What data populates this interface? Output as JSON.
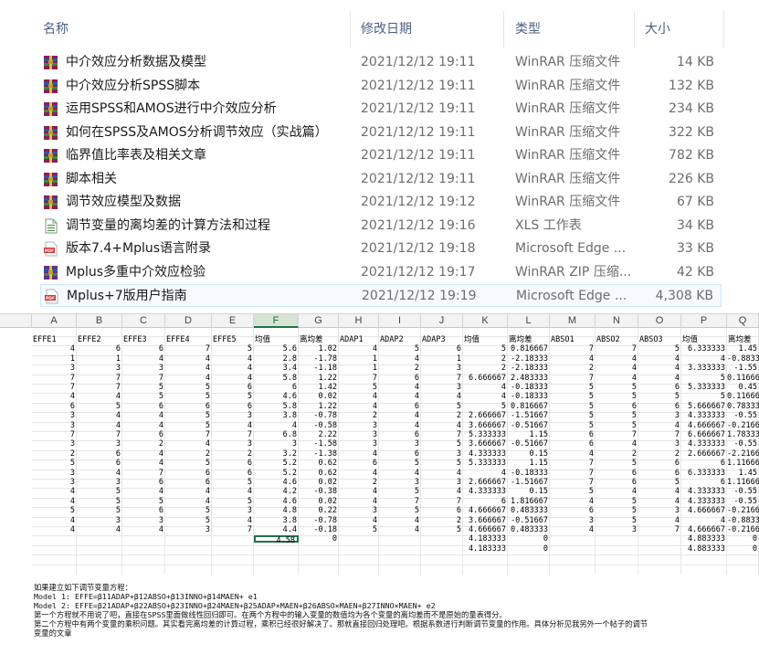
{
  "explorer": {
    "headers": {
      "name": "名称",
      "date": "修改日期",
      "type": "类型",
      "size": "大小"
    },
    "files": [
      {
        "name": "中介效应分析数据及模型",
        "date": "2021/12/12 19:11",
        "type": "WinRAR 压缩文件",
        "size": "14 KB",
        "icon": "winrar-archive-icon"
      },
      {
        "name": "中介效应分析SPSS脚本",
        "date": "2021/12/12 19:11",
        "type": "WinRAR 压缩文件",
        "size": "132 KB",
        "icon": "winrar-archive-icon"
      },
      {
        "name": "运用SPSS和AMOS进行中介效应分析",
        "date": "2021/12/12 19:11",
        "type": "WinRAR 压缩文件",
        "size": "234 KB",
        "icon": "winrar-archive-icon"
      },
      {
        "name": "如何在SPSS及AMOS分析调节效应（实战篇）",
        "date": "2021/12/12 19:11",
        "type": "WinRAR 压缩文件",
        "size": "322 KB",
        "icon": "winrar-archive-icon"
      },
      {
        "name": "临界值比率表及相关文章",
        "date": "2021/12/12 19:11",
        "type": "WinRAR 压缩文件",
        "size": "782 KB",
        "icon": "winrar-archive-icon"
      },
      {
        "name": "脚本相关",
        "date": "2021/12/12 19:11",
        "type": "WinRAR 压缩文件",
        "size": "226 KB",
        "icon": "winrar-archive-icon"
      },
      {
        "name": "调节效应模型及数据",
        "date": "2021/12/12 19:12",
        "type": "WinRAR 压缩文件",
        "size": "67 KB",
        "icon": "winrar-archive-icon"
      },
      {
        "name": "调节变量的离均差的计算方法和过程",
        "date": "2021/12/12 19:16",
        "type": "XLS 工作表",
        "size": "34 KB",
        "icon": "xls-sheet-icon"
      },
      {
        "name": "版本7.4+Mplus语言附录",
        "date": "2021/12/12 19:18",
        "type": "Microsoft Edge ...",
        "size": "33 KB",
        "icon": "pdf-icon"
      },
      {
        "name": "Mplus多重中介效应检验",
        "date": "2021/12/12 19:17",
        "type": "WinRAR ZIP 压缩...",
        "size": "42 KB",
        "icon": "winrar-zip-icon"
      },
      {
        "name": "Mplus+7版用户指南",
        "date": "2021/12/12 19:19",
        "type": "Microsoft Edge ...",
        "size": "4,308 KB",
        "icon": "pdf-icon"
      }
    ]
  },
  "sheet": {
    "columns": [
      "A",
      "B",
      "C",
      "D",
      "E",
      "F",
      "G",
      "H",
      "I",
      "J",
      "K",
      "L",
      "M",
      "N",
      "O",
      "P",
      "Q"
    ],
    "active_column": "F",
    "header_row": [
      "EFFE1",
      "EFFE2",
      "EFFE3",
      "EFFE4",
      "EFFE5",
      "均值",
      "离均差",
      "ADAP1",
      "ADAP2",
      "ADAP3",
      "均值",
      "离均差",
      "ABSO1",
      "ABSO2",
      "ABSO3",
      "均值",
      "离均差"
    ],
    "rows": [
      [
        "4",
        "6",
        "6",
        "7",
        "5",
        "5.6",
        "1.02",
        "4",
        "5",
        "6",
        "5",
        "0.816667",
        "7",
        "7",
        "5",
        "6.333333",
        "1.45"
      ],
      [
        "1",
        "1",
        "4",
        "4",
        "4",
        "2.8",
        "-1.78",
        "1",
        "4",
        "1",
        "2",
        "-2.18333",
        "4",
        "4",
        "4",
        "4",
        "-0.88333"
      ],
      [
        "3",
        "3",
        "3",
        "4",
        "4",
        "3.4",
        "-1.18",
        "1",
        "2",
        "3",
        "2",
        "-2.18333",
        "2",
        "4",
        "4",
        "3.333333",
        "-1.55"
      ],
      [
        "7",
        "7",
        "7",
        "4",
        "4",
        "5.8",
        "1.22",
        "7",
        "6",
        "7",
        "6.666667",
        "2.483333",
        "7",
        "4",
        "4",
        "5",
        "0.116667"
      ],
      [
        "7",
        "7",
        "5",
        "5",
        "6",
        "6",
        "1.42",
        "5",
        "4",
        "3",
        "4",
        "-0.18333",
        "5",
        "5",
        "6",
        "5.333333",
        "0.45"
      ],
      [
        "4",
        "4",
        "5",
        "5",
        "5",
        "4.6",
        "0.02",
        "4",
        "4",
        "4",
        "4",
        "-0.18333",
        "5",
        "5",
        "5",
        "5",
        "0.116667"
      ],
      [
        "6",
        "5",
        "6",
        "6",
        "6",
        "5.8",
        "1.22",
        "4",
        "6",
        "5",
        "5",
        "0.816667",
        "5",
        "6",
        "6",
        "5.666667",
        "0.783333"
      ],
      [
        "3",
        "4",
        "4",
        "5",
        "3",
        "3.8",
        "-0.78",
        "2",
        "4",
        "2",
        "2.666667",
        "-1.51667",
        "5",
        "5",
        "3",
        "4.333333",
        "-0.55"
      ],
      [
        "3",
        "4",
        "4",
        "5",
        "4",
        "4",
        "-0.58",
        "3",
        "4",
        "4",
        "3.666667",
        "-0.51667",
        "5",
        "5",
        "4",
        "4.666667",
        "-0.21667"
      ],
      [
        "7",
        "7",
        "6",
        "7",
        "7",
        "6.8",
        "2.22",
        "3",
        "6",
        "7",
        "5.333333",
        "1.15",
        "6",
        "7",
        "7",
        "6.666667",
        "1.783333"
      ],
      [
        "3",
        "3",
        "2",
        "4",
        "3",
        "3",
        "-1.58",
        "3",
        "3",
        "5",
        "3.666667",
        "-0.51667",
        "6",
        "4",
        "3",
        "4.333333",
        "-0.55"
      ],
      [
        "2",
        "6",
        "4",
        "2",
        "2",
        "3.2",
        "-1.38",
        "4",
        "6",
        "3",
        "4.333333",
        "0.15",
        "4",
        "2",
        "2",
        "2.666667",
        "-2.21667"
      ],
      [
        "5",
        "6",
        "4",
        "5",
        "6",
        "5.2",
        "0.62",
        "6",
        "5",
        "5",
        "5.333333",
        "1.15",
        "7",
        "5",
        "6",
        "6",
        "1.116667"
      ],
      [
        "3",
        "4",
        "7",
        "6",
        "6",
        "5.2",
        "0.62",
        "4",
        "4",
        "4",
        "4",
        "-0.18333",
        "7",
        "6",
        "6",
        "6.333333",
        "1.45"
      ],
      [
        "3",
        "3",
        "6",
        "6",
        "5",
        "4.6",
        "0.02",
        "2",
        "3",
        "3",
        "2.666667",
        "-1.51667",
        "7",
        "6",
        "5",
        "6",
        "1.116667"
      ],
      [
        "4",
        "5",
        "4",
        "4",
        "4",
        "4.2",
        "-0.38",
        "4",
        "5",
        "4",
        "4.333333",
        "0.15",
        "5",
        "4",
        "4",
        "4.333333",
        "-0.55"
      ],
      [
        "4",
        "5",
        "5",
        "4",
        "5",
        "4.6",
        "0.02",
        "4",
        "7",
        "7",
        "6",
        "1.816667",
        "4",
        "5",
        "4",
        "4.333333",
        "-0.55"
      ],
      [
        "5",
        "5",
        "6",
        "5",
        "3",
        "4.8",
        "0.22",
        "3",
        "5",
        "6",
        "4.666667",
        "0.483333",
        "6",
        "5",
        "3",
        "4.666667",
        "-0.21667"
      ],
      [
        "4",
        "3",
        "3",
        "5",
        "4",
        "3.8",
        "-0.78",
        "4",
        "4",
        "2",
        "3.666667",
        "-0.51667",
        "3",
        "5",
        "4",
        "4",
        "-0.88333"
      ],
      [
        "4",
        "4",
        "4",
        "3",
        "7",
        "4.4",
        "-0.18",
        "5",
        "4",
        "5",
        "4.666667",
        "0.483333",
        "4",
        "3",
        "7",
        "4.666667",
        "-0.21667"
      ],
      [
        "",
        "",
        "",
        "",
        "",
        "4.58",
        "0",
        "",
        "",
        "",
        "4.183333",
        "0",
        "",
        "",
        "",
        "4.883333",
        "0"
      ],
      [
        "",
        "",
        "",
        "",
        "",
        "",
        "",
        "",
        "",
        "",
        "4.183333",
        "0",
        "",
        "",
        "",
        "4.883333",
        "0"
      ]
    ],
    "notes": [
      "如果建立如下调节变量方程：",
      "Model 1: EFFE=β11ADAP+β12ABSO+β13INNO+β14MAEN+ e1",
      "Model 2: EFFE=β21ADAP+β22ABSO+β23INNO+β24MAEN+β25ADAP×MAEN+β26ABSO×MAEN+β27INNO×MAEN+ e2",
      "第一个方程就不用说了吧，直接在SPSS里面做线性回归即可。在两个方程中的输入变量的数值均为各个变量的离均差而不是原始的量表得分。",
      "第二个方程中有两个变量的乘积问题。其实看完离均差的计算过程，乘积已经很好解决了。那就直接回归处理吧。根据系数进行判断调节变量的作用。具体分析见我另外一个帖子的调节",
      "变量的文章"
    ]
  },
  "colors": {
    "accent": "#217346",
    "selection": "#cde8ff"
  }
}
